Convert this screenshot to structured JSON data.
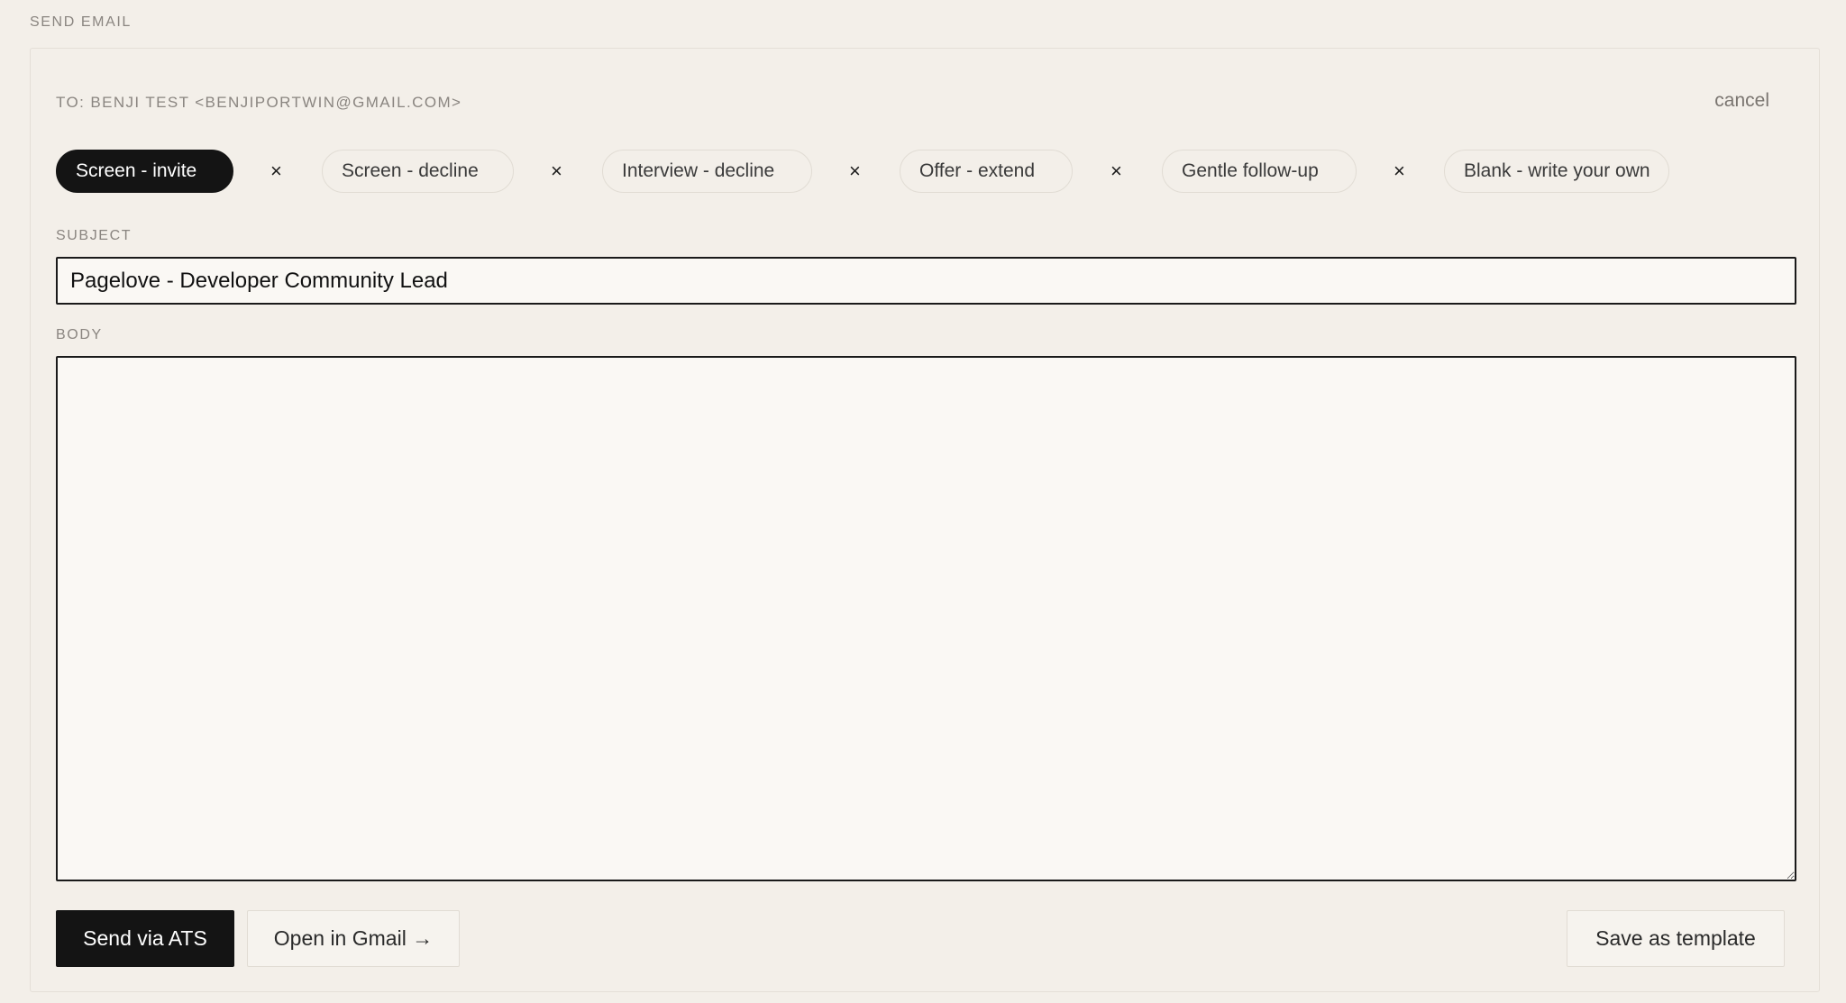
{
  "section_title": "SEND EMAIL",
  "recipient_line": "TO: BENJI TEST <BENJIPORTWIN@GMAIL.COM>",
  "cancel_label": "cancel",
  "templates": [
    {
      "label": "Screen - invite",
      "active": true
    },
    {
      "label": "Screen - decline",
      "active": false
    },
    {
      "label": "Interview - decline",
      "active": false
    },
    {
      "label": "Offer - extend",
      "active": false
    },
    {
      "label": "Gentle follow-up",
      "active": false
    },
    {
      "label": "Blank - write your own",
      "active": false
    }
  ],
  "remove_glyph": "×",
  "subject": {
    "label": "SUBJECT",
    "value": "Pagelove - Developer Community Lead"
  },
  "body": {
    "label": "BODY",
    "value": ""
  },
  "actions": {
    "send_label": "Send via ATS",
    "gmail_label": "Open in Gmail →",
    "save_template_label": "Save as template"
  },
  "colors": {
    "background": "#f3efe9",
    "accent_dark": "#141414",
    "muted_text": "#8a8580"
  }
}
